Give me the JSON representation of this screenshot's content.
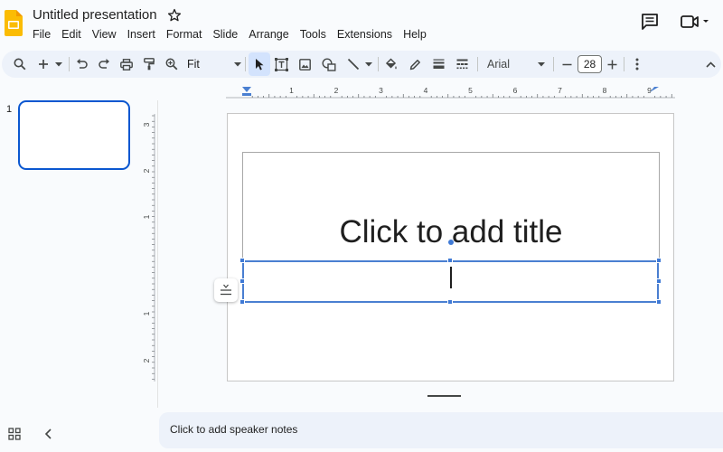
{
  "header": {
    "title": "Untitled presentation",
    "menu": [
      "File",
      "Edit",
      "View",
      "Insert",
      "Format",
      "Slide",
      "Arrange",
      "Tools",
      "Extensions",
      "Help"
    ]
  },
  "toolbar": {
    "zoom": "Fit",
    "font": "Arial",
    "font_size": "28",
    "tools": [
      "search-icon",
      "new-slide-icon",
      "undo-icon",
      "redo-icon",
      "print-icon",
      "paint-format-icon",
      "zoom-icon",
      "select-icon",
      "text-box-icon",
      "image-icon",
      "shape-icon",
      "line-icon",
      "fill-color-icon",
      "border-color-icon",
      "border-weight-icon",
      "border-dash-icon",
      "decrease-font-icon",
      "increase-font-icon",
      "more-icon",
      "collapse-toolbar-icon"
    ]
  },
  "filmstrip": {
    "slide_number": "1"
  },
  "ruler": {
    "horizontal_ticks": [
      "1",
      "2",
      "3",
      "4",
      "5",
      "6",
      "7",
      "8",
      "9"
    ],
    "vertical_ticks": [
      "3",
      "2",
      "1",
      "1",
      "2"
    ]
  },
  "slide": {
    "title_placeholder": "Click to add title"
  },
  "notes": {
    "placeholder": "Click to add speaker notes"
  },
  "colors": {
    "accent": "#0b57d0",
    "selection": "#3f7ad6",
    "toolbar_bg": "#edf2fa",
    "logo": "#fbbc04"
  }
}
